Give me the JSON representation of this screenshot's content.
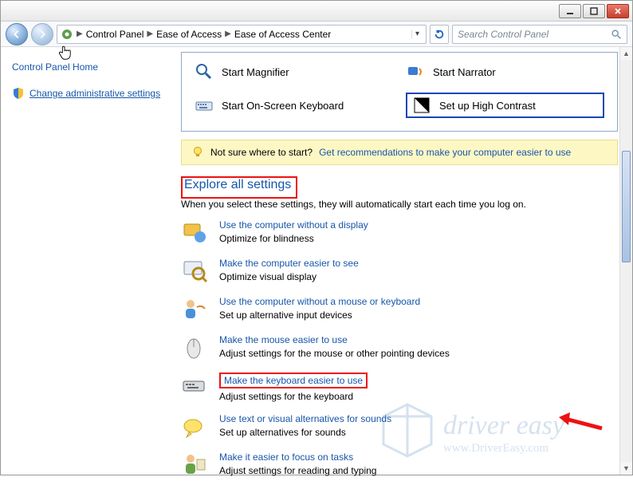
{
  "titlebar": {
    "min": "",
    "max": "",
    "close": ""
  },
  "addr": {
    "segments": [
      "Control Panel",
      "Ease of Access",
      "Ease of Access Center"
    ]
  },
  "search": {
    "placeholder": "Search Control Panel"
  },
  "sidebar": {
    "home": "Control Panel Home",
    "admin": "Change administrative settings"
  },
  "quick": {
    "magnifier": "Start Magnifier",
    "osk": "Start On-Screen Keyboard",
    "narrator": "Start Narrator",
    "contrast": "Set up High Contrast"
  },
  "hint": {
    "lead": "Not sure where to start?",
    "link": "Get recommendations to make your computer easier to use"
  },
  "section": {
    "title": "Explore all settings",
    "sub": "When you select these settings, they will automatically start each time you log on."
  },
  "items": [
    {
      "link": "Use the computer without a display",
      "desc": "Optimize for blindness"
    },
    {
      "link": "Make the computer easier to see",
      "desc": "Optimize visual display"
    },
    {
      "link": "Use the computer without a mouse or keyboard",
      "desc": "Set up alternative input devices"
    },
    {
      "link": "Make the mouse easier to use",
      "desc": "Adjust settings for the mouse or other pointing devices"
    },
    {
      "link": "Make the keyboard easier to use",
      "desc": "Adjust settings for the keyboard"
    },
    {
      "link": "Use text or visual alternatives for sounds",
      "desc": "Set up alternatives for sounds"
    },
    {
      "link": "Make it easier to focus on tasks",
      "desc": "Adjust settings for reading and typing"
    }
  ],
  "watermark": {
    "brand": "driver easy",
    "url": "www.DriverEasy.com"
  },
  "annotations": {
    "highlighted_link_index": 4
  },
  "colors": {
    "link": "#1756a9",
    "highlight_border": "#e11",
    "hint_bg": "#fdf7c4"
  }
}
